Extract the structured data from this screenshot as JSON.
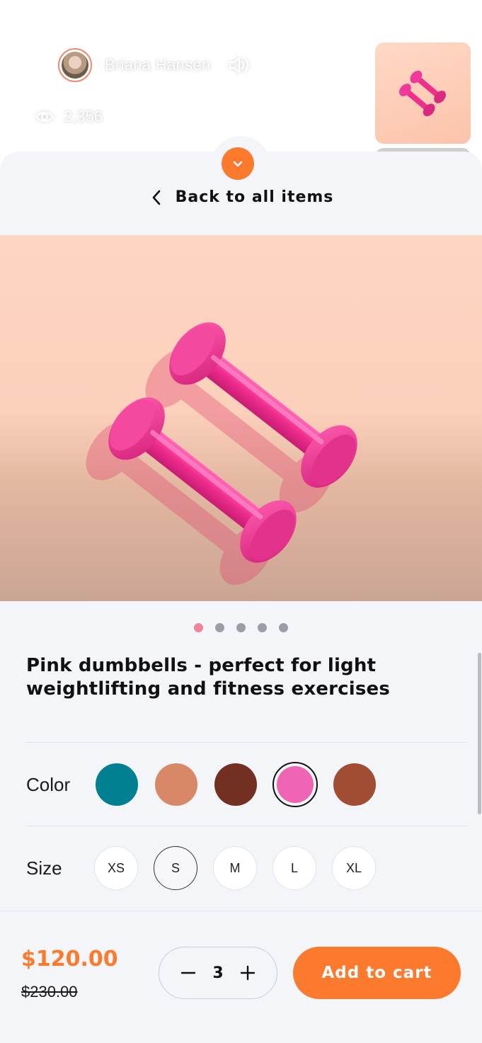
{
  "stream": {
    "streamer_name": "Briana Hansen",
    "viewer_count": "2,356",
    "avatar_icon": "user-avatar",
    "sound_icon": "speaker-icon",
    "viewers_icon": "eye-icon"
  },
  "sheet": {
    "collapse_icon": "chevron-down-icon",
    "back_label": "Back to all items",
    "back_icon": "chevron-left-icon"
  },
  "product": {
    "image": "pink-dumbbells-photo",
    "carousel": {
      "total": 5,
      "active_index": 0
    },
    "title": "Pink dumbbells - perfect for light weightlifting and fitness exercises",
    "color_label": "Color",
    "colors": [
      "#008090",
      "#d88866",
      "#732f22",
      "#f064b4",
      "#a04d33"
    ],
    "selected_color_index": 3,
    "size_label": "Size",
    "sizes": [
      "XS",
      "S",
      "M",
      "L",
      "XL"
    ],
    "selected_size_index": 1
  },
  "cart": {
    "price_now": "$120.00",
    "price_was": "$230.00",
    "quantity": "3",
    "add_label": "Add to cart",
    "minus_icon": "minus-icon",
    "plus_icon": "plus-icon"
  },
  "colors": {
    "accent": "#fb7a2e",
    "sheet_bg": "#f4f5f9",
    "dot_active": "#f0849a",
    "dot_inactive": "#9b9ea6"
  }
}
